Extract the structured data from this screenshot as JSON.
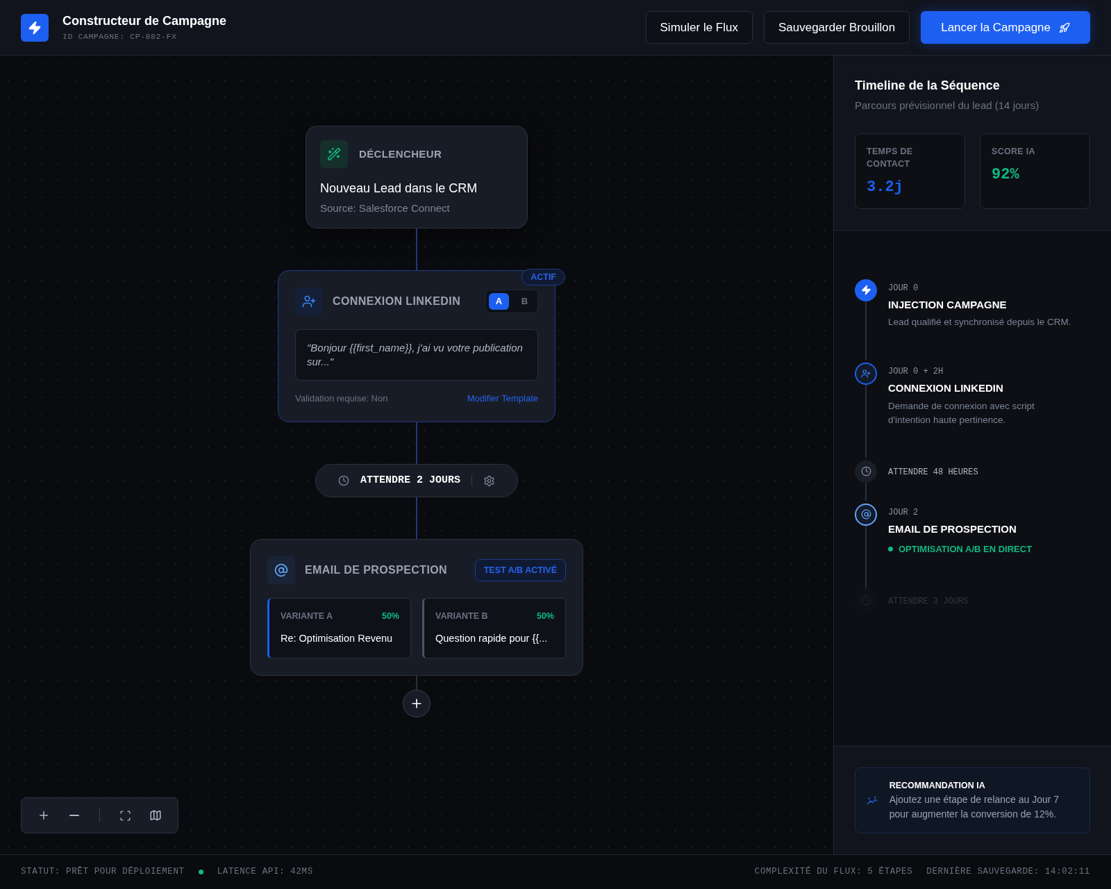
{
  "header": {
    "title": "Constructeur de Campagne",
    "campaign_id": "ID CAMPAGNE: CP-882-FX",
    "buttons": [
      {
        "label": "Simuler le Flux",
        "kind": "secondary"
      },
      {
        "label": "Sauvegarder Brouillon",
        "kind": "secondary"
      },
      {
        "label": "Lancer la Campagne",
        "kind": "primary"
      }
    ]
  },
  "canvas": {
    "trigger": {
      "kicker": "DÉCLENCHEUR",
      "title": "Nouveau Lead dans le CRM",
      "source": "Source: Salesforce Connect"
    },
    "linkedin": {
      "title": "CONNEXION LINKEDIN",
      "selected": true,
      "variants": [
        {
          "label": "A",
          "selected": true
        },
        {
          "label": "B",
          "selected": false
        }
      ],
      "badge": "ACTIF",
      "message": "\"Bonjour {{first_name}}, j'ai vu votre publication sur...\"",
      "validation": "Validation requise: Non",
      "link": "Modifier Template"
    },
    "wait": {
      "label": "ATTENDRE 2 JOURS"
    },
    "email": {
      "title": "EMAIL DE PROSPECTION",
      "badge": "TEST A/B ACTIVÉ",
      "variants": [
        {
          "label": "VARIANTE A",
          "share": "50%",
          "subject": "Re: Optimisation Revenu",
          "selected": true
        },
        {
          "label": "VARIANTE B",
          "share": "50%",
          "subject": "Question rapide pour {{...",
          "selected": false
        }
      ]
    }
  },
  "sidebar": {
    "title": "Timeline de la Séquence",
    "subtitle": "Parcours prévisionnel du lead (14 jours)",
    "stats": [
      {
        "label": "TEMPS DE CONTACT",
        "value": "3.2j",
        "color": "#1d5ff0"
      },
      {
        "label": "SCORE IA",
        "value": "92%",
        "color": "#10b981"
      }
    ],
    "timeline": [
      {
        "kind": "trigger",
        "day": "JOUR 0",
        "title": "INJECTION CAMPAGNE",
        "description": "Lead qualifié et synchronisé depuis le CRM.",
        "disabled": false
      },
      {
        "kind": "linkedin",
        "day": "JOUR 0 + 2H",
        "title": "CONNEXION LINKEDIN",
        "description": "Demande de connexion avec script d'intention haute pertinence.",
        "disabled": false
      },
      {
        "kind": "wait",
        "label": "ATTENDRE 48 HEURES",
        "disabled": false
      },
      {
        "kind": "email",
        "day": "JOUR 2",
        "title": "EMAIL DE PROSPECTION",
        "status": "OPTIMISATION A/B EN DIRECT",
        "disabled": false
      },
      {
        "kind": "wait",
        "label": "ATTENDRE 3 JOURS",
        "disabled": true
      }
    ],
    "recommendation": {
      "title": "RECOMMANDATION IA",
      "text": "Ajoutez une étape de relance au Jour 7 pour augmenter la conversion de 12%."
    }
  },
  "status_bar": {
    "left": [
      "STATUT: PRÊT POUR DÉPLOIEMENT",
      "LATENCE API: 42MS"
    ],
    "right": [
      "COMPLEXITÉ DU FLUX: 5 ÉTAPES",
      "DERNIÈRE SAUVEGARDE: 14:02:11"
    ]
  }
}
